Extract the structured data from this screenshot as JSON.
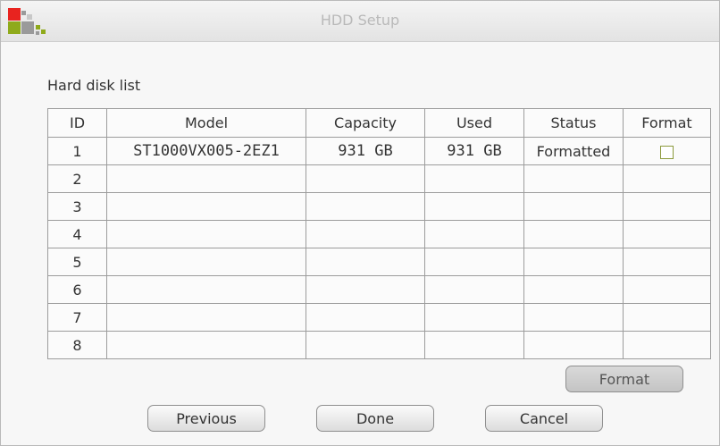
{
  "window": {
    "title": "HDD Setup"
  },
  "section": {
    "label": "Hard disk list"
  },
  "table": {
    "headers": [
      "ID",
      "Model",
      "Capacity",
      "Used",
      "Status",
      "Format"
    ],
    "rows": [
      {
        "id": "1",
        "model": "ST1000VX005-2EZ1",
        "capacity": "931 GB",
        "used": "931 GB",
        "status": "Formatted",
        "format_checked": false
      },
      {
        "id": "2",
        "model": "",
        "capacity": "",
        "used": "",
        "status": ""
      },
      {
        "id": "3",
        "model": "",
        "capacity": "",
        "used": "",
        "status": ""
      },
      {
        "id": "4",
        "model": "",
        "capacity": "",
        "used": "",
        "status": ""
      },
      {
        "id": "5",
        "model": "",
        "capacity": "",
        "used": "",
        "status": ""
      },
      {
        "id": "6",
        "model": "",
        "capacity": "",
        "used": "",
        "status": ""
      },
      {
        "id": "7",
        "model": "",
        "capacity": "",
        "used": "",
        "status": ""
      },
      {
        "id": "8",
        "model": "",
        "capacity": "",
        "used": "",
        "status": ""
      }
    ]
  },
  "buttons": {
    "format": "Format",
    "previous": "Previous",
    "done": "Done",
    "cancel": "Cancel"
  },
  "colors": {
    "logo_red": "#e8231f",
    "logo_green": "#8faa1b",
    "logo_gray": "#9a9a9a"
  }
}
